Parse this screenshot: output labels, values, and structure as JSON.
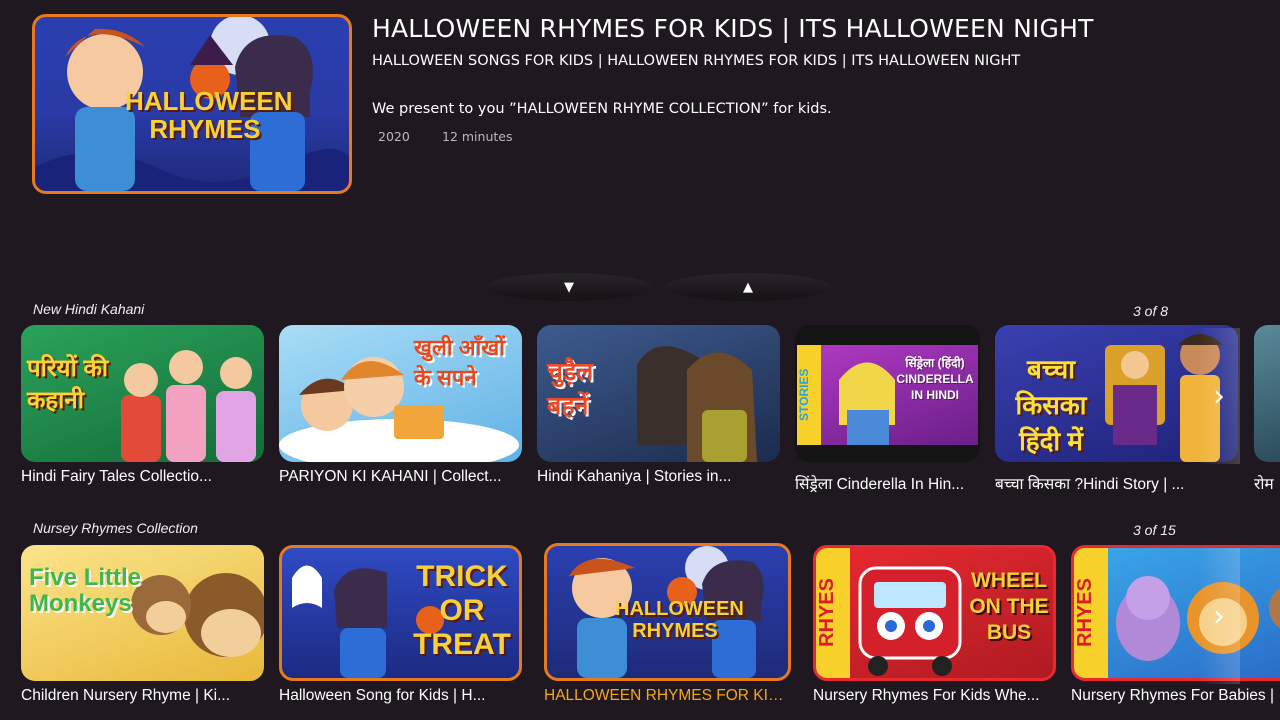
{
  "hero": {
    "thumb_art_text": "HALLOWEEN RHYMES",
    "title": "HALLOWEEN RHYMES FOR KIDS | ITS HALLOWEEN NIGHT",
    "subtitle": "HALLOWEEN SONGS FOR KIDS | HALLOWEEN RHYMES FOR KIDS | ITS HALLOWEEN NIGHT",
    "description": "We present to you ”HALLOWEEN RHYME COLLECTION” for kids.",
    "year": "2020",
    "duration": "12 minutes"
  },
  "nav": {
    "down_icon": "▼",
    "up_icon": "▲"
  },
  "rows": [
    {
      "title": "New Hindi Kahani",
      "count": "3 of 8",
      "cards": [
        {
          "caption": "Hindi Fairy Tales Collectio...",
          "art": "परियों की कहानी",
          "color": "#1f8f4d"
        },
        {
          "caption": "PARIYON KI KAHANI | Collect...",
          "art": "खुली आँखों के सपने",
          "color": "#7ec6ee"
        },
        {
          "caption": "Hindi Kahaniya | Stories in...",
          "art": "चुड़ैल बहनें",
          "color": "#2a3f6a"
        },
        {
          "caption": "सिंड्रेला Cinderella In Hin...",
          "art": "सिंड्रेला (हिंदी) CINDERELLA IN HINDI",
          "side": "STORIES",
          "color": "#9b2fb0"
        },
        {
          "caption": "बच्चा किसका ?Hindi Story | ...",
          "art": "बच्चा किसका हिंदी में",
          "color": "#2a2f8f"
        },
        {
          "caption": "रोम",
          "color": "#3b5a6a"
        }
      ]
    },
    {
      "title": "Nursey Rhymes Collection",
      "count": "3 of 15",
      "cards": [
        {
          "caption": "Children Nursery Rhyme | Ki...",
          "art": "Five Little Monkeys",
          "color": "#f3d35a"
        },
        {
          "caption": "Halloween Song for Kids | H...",
          "art": "TRICK OR TREAT",
          "color": "#2a46b8"
        },
        {
          "caption": "HALLOWEEN RHYMES FOR KIDS |...",
          "art": "HALLOWEEN RHYMES",
          "color": "#2a46b8"
        },
        {
          "caption": "Nursery Rhymes For Kids Whe...",
          "art": "WHEEL ON THE BUS",
          "side": "RHYES",
          "color": "#d91e2a"
        },
        {
          "caption": "Nursery Rhymes For Babies |",
          "side": "RHYES",
          "color": "#d91e2a"
        }
      ]
    }
  ],
  "icons": {
    "next": "chevron-right-icon"
  },
  "colors": {
    "background": "#1f1820",
    "focus": "#e87a1e",
    "focus_text": "#f5a623"
  }
}
